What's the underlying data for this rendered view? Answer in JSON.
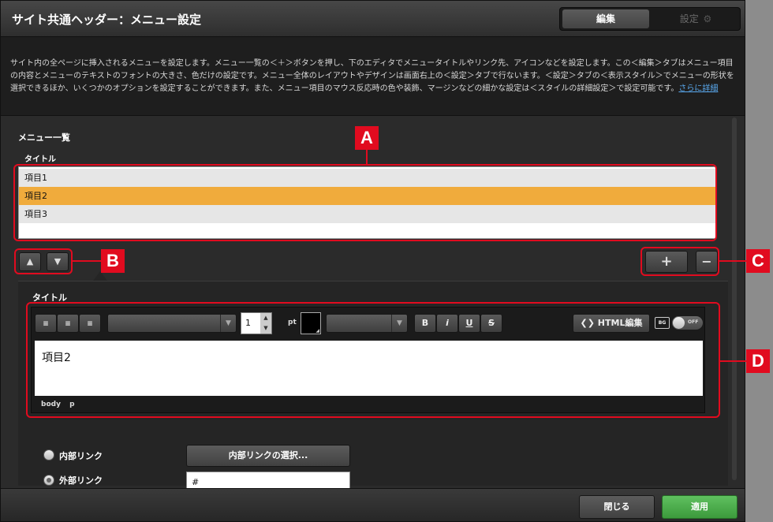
{
  "window": {
    "title": "サイト共通ヘッダー：メニュー設定"
  },
  "mode_tabs": {
    "edit": "編集",
    "settings": "設定"
  },
  "description": {
    "text": "サイト内の全ページに挿入されるメニューを設定します。メニュー一覧の＜＋＞ボタンを押し、下のエディタでメニュータイトルやリンク先、アイコンなどを設定します。この＜編集＞タブはメニュー項目の内容とメニューのテキストのフォントの大きさ、色だけの設定です。メニュー全体のレイアウトやデザインは画面右上の＜設定＞タブで行ないます。＜設定＞タブの＜表示スタイル＞でメニューの形状を選択できるほか、いくつかのオプションを設定することができます。また、メニュー項目のマウス反応時の色や装飾、マージンなどの細かな設定は＜スタイルの詳細設定＞で設定可能です。",
    "link": "さらに詳細"
  },
  "menu_list": {
    "section_label": "メニュー一覧",
    "column_label": "タイトル",
    "items": [
      {
        "label": "項目1",
        "selected": false
      },
      {
        "label": "項目2",
        "selected": true
      },
      {
        "label": "項目3",
        "selected": false
      }
    ],
    "move_up_icon": "triangle-up-icon",
    "move_down_icon": "triangle-down-icon",
    "add_label": "+",
    "remove_label": "−"
  },
  "editor": {
    "title_label": "タイトル",
    "font_size": "1",
    "font_unit": "pt",
    "text_color": "#000000",
    "bold": "B",
    "italic": "i",
    "underline": "U",
    "strike": "S",
    "html_edit": "HTML編集",
    "bg_label": "BG",
    "toggle_state": "OFF",
    "content": "項目2",
    "path_body": "body",
    "path_p": "p"
  },
  "link": {
    "internal_label": "内部リンク",
    "external_label": "外部リンク",
    "external_selected": true,
    "internal_button": "内部リンクの選択...",
    "external_value": "#"
  },
  "footer": {
    "close": "閉じる",
    "apply": "適用"
  },
  "annotations": {
    "a": "A",
    "b": "B",
    "c": "C",
    "d": "D"
  },
  "colors": {
    "selected_row": "#f0ab3c",
    "apply_button": "#4caf50",
    "annotation_red": "#e10b1f",
    "link_blue": "#5aaaf0"
  }
}
